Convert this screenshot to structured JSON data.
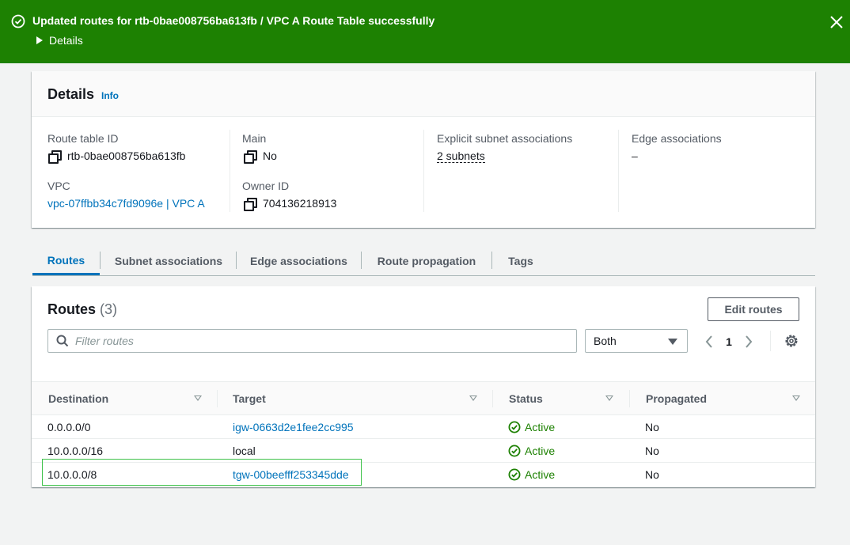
{
  "flash": {
    "title": "Updated routes for rtb-0bae008756ba613fb / VPC A Route Table successfully",
    "details_label": "Details"
  },
  "details": {
    "title": "Details",
    "info": "Info",
    "route_table_id_label": "Route table ID",
    "route_table_id": "rtb-0bae008756ba613fb",
    "vpc_label": "VPC",
    "vpc_value": "vpc-07ffbb34c7fd9096e | VPC A",
    "main_label": "Main",
    "main_value": "No",
    "owner_label": "Owner ID",
    "owner_value": "704136218913",
    "explicit_label": "Explicit subnet associations",
    "explicit_value": "2 subnets",
    "edge_label": "Edge associations",
    "edge_value": "–"
  },
  "tabs": [
    {
      "label": "Routes",
      "active": true
    },
    {
      "label": "Subnet associations",
      "active": false
    },
    {
      "label": "Edge associations",
      "active": false
    },
    {
      "label": "Route propagation",
      "active": false
    },
    {
      "label": "Tags",
      "active": false
    }
  ],
  "routes": {
    "title": "Routes",
    "count": "(3)",
    "edit_button": "Edit routes",
    "filter_placeholder": "Filter routes",
    "select_value": "Both",
    "page": "1",
    "columns": [
      "Destination",
      "Target",
      "Status",
      "Propagated"
    ],
    "rows": [
      {
        "destination": "0.0.0.0/0",
        "target": "igw-0663d2e1fee2cc995",
        "target_link": true,
        "status": "Active",
        "propagated": "No"
      },
      {
        "destination": "10.0.0.0/16",
        "target": "local",
        "target_link": false,
        "status": "Active",
        "propagated": "No"
      },
      {
        "destination": "10.0.0.0/8",
        "target": "tgw-00beefff253345dde",
        "target_link": true,
        "status": "Active",
        "propagated": "No"
      }
    ]
  },
  "colors": {
    "success": "#1d8102",
    "link": "#0073bb",
    "highlight": "#3ec24a"
  }
}
